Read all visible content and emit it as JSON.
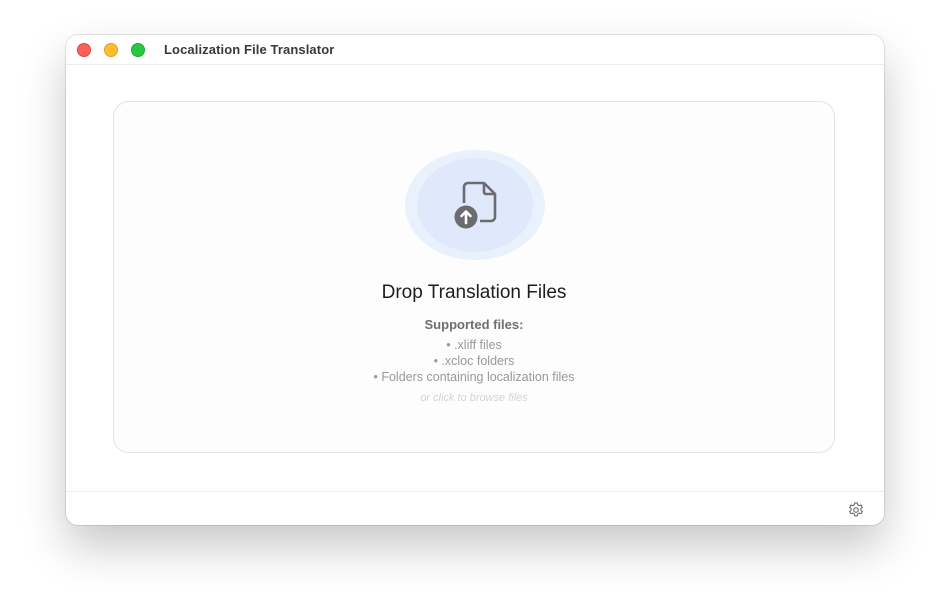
{
  "window": {
    "title": "Localization File Translator"
  },
  "dropzone": {
    "heading": "Drop Translation Files",
    "supported_title": "Supported files:",
    "supported_items": [
      "• .xliff files",
      "• .xcloc folders",
      "• Folders containing localization files"
    ],
    "browse_hint": "or click to browse files",
    "icon": "document-upload-icon"
  },
  "footer": {
    "settings_icon": "gear-icon"
  },
  "colors": {
    "close": "#fe5f57",
    "minimize": "#febc2e",
    "maximize": "#28c840",
    "icon_bg": "#dfe9fb"
  }
}
